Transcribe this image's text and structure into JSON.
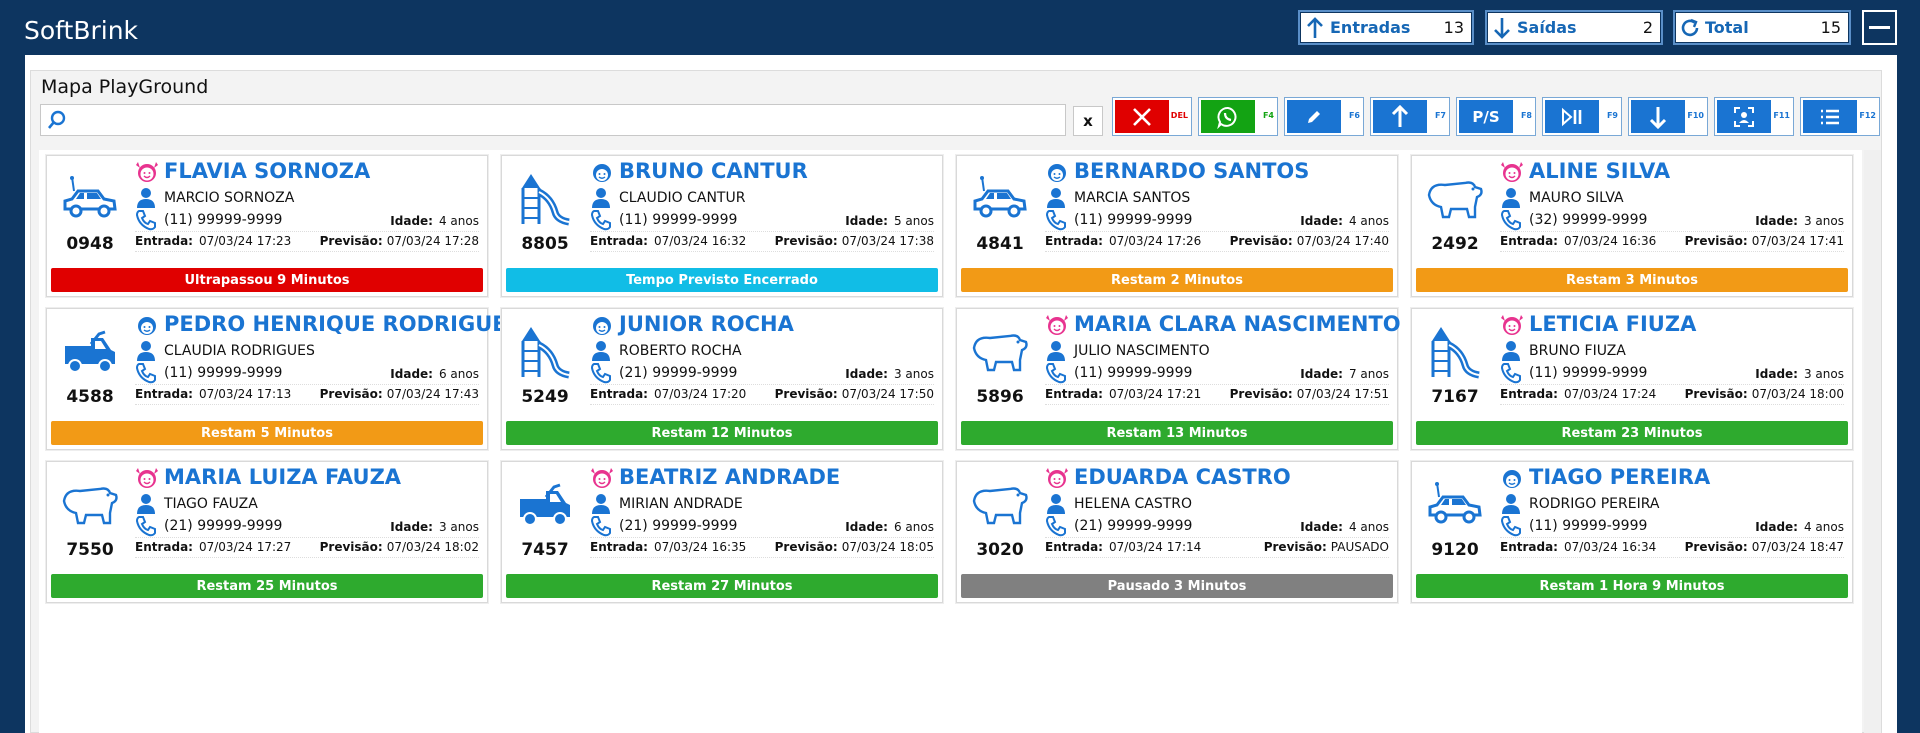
{
  "app": {
    "title": "SoftBrink"
  },
  "counters": [
    {
      "label": "Entradas",
      "value": "13",
      "icon": "arrow-up-icon"
    },
    {
      "label": "Saídas",
      "value": "2",
      "icon": "arrow-down-icon"
    },
    {
      "label": "Total",
      "value": "15",
      "icon": "refresh-icon"
    }
  ],
  "panel": {
    "title": "Mapa PlayGround"
  },
  "search": {
    "value": "",
    "placeholder": "",
    "clear_label": "x"
  },
  "toolbar": [
    {
      "name": "delete-button",
      "key": "DEL",
      "icon": "close-icon"
    },
    {
      "name": "whatsapp-button",
      "key": "F4",
      "icon": "whatsapp-icon"
    },
    {
      "name": "edit-button",
      "key": "F6",
      "icon": "pencil-icon"
    },
    {
      "name": "entry-button",
      "key": "F7",
      "icon": "arrow-up-icon"
    },
    {
      "name": "ps-button",
      "key": "F8",
      "icon": "ps-text-icon",
      "text": "P/S"
    },
    {
      "name": "play-pause-button",
      "key": "F9",
      "icon": "play-pause-icon"
    },
    {
      "name": "exit-button",
      "key": "F10",
      "icon": "arrow-down-icon"
    },
    {
      "name": "face-scan-button",
      "key": "F11",
      "icon": "face-scan-icon"
    },
    {
      "name": "list-button",
      "key": "F12",
      "icon": "list-icon"
    }
  ],
  "colors": {
    "header_bg": "#0d3560",
    "accent": "#1a74d2",
    "status_red": "#e00000",
    "status_cyan": "#11bde6",
    "status_orange": "#f29a16",
    "status_green": "#2eaa2e",
    "status_gray": "#808080",
    "girl_icon": "#e8338f",
    "boy_icon": "#1a74d2"
  },
  "labels": {
    "age": "Idade:",
    "entry": "Entrada:",
    "forecast": "Previsão:"
  },
  "cards": [
    {
      "code": "0948",
      "icon": "car-icon",
      "gender": "girl",
      "name": "FLAVIA SORNOZA",
      "parent": "MARCIO SORNOZA",
      "phone": "(11) 99999-9999",
      "age": "4 anos",
      "entry": "07/03/24 17:23",
      "forecast": "07/03/24 17:28",
      "status": "Ultrapassou 9 Minutos",
      "status_color": "red"
    },
    {
      "code": "8805",
      "icon": "slide-icon",
      "gender": "boy",
      "name": "BRUNO CANTUR",
      "parent": "CLAUDIO CANTUR",
      "phone": "(11) 99999-9999",
      "age": "5 anos",
      "entry": "07/03/24 16:32",
      "forecast": "07/03/24 17:38",
      "status": "Tempo Previsto Encerrado",
      "status_color": "cyan"
    },
    {
      "code": "4841",
      "icon": "car-icon",
      "gender": "boy",
      "name": "BERNARDO SANTOS",
      "parent": "MARCIA SANTOS",
      "phone": "(11) 99999-9999",
      "age": "4 anos",
      "entry": "07/03/24 17:26",
      "forecast": "07/03/24 17:40",
      "status": "Restam 2 Minutos",
      "status_color": "orange"
    },
    {
      "code": "2492",
      "icon": "bear-icon",
      "gender": "girl",
      "name": "ALINE SILVA",
      "parent": "MAURO SILVA",
      "phone": "(32) 99999-9999",
      "age": "3 anos",
      "entry": "07/03/24 16:36",
      "forecast": "07/03/24 17:41",
      "status": "Restam 3 Minutos",
      "status_color": "orange"
    },
    {
      "code": "4588",
      "icon": "truck-icon",
      "gender": "boy",
      "name": "PEDRO HENRIQUE RODRIGUES",
      "parent": "CLAUDIA RODRIGUES",
      "phone": "(11) 99999-9999",
      "age": "6 anos",
      "entry": "07/03/24 17:13",
      "forecast": "07/03/24 17:43",
      "status": "Restam 5 Minutos",
      "status_color": "orange"
    },
    {
      "code": "5249",
      "icon": "slide-icon",
      "gender": "boy",
      "name": "JUNIOR ROCHA",
      "parent": "ROBERTO ROCHA",
      "phone": "(21) 99999-9999",
      "age": "3 anos",
      "entry": "07/03/24 17:20",
      "forecast": "07/03/24 17:50",
      "status": "Restam 12 Minutos",
      "status_color": "green"
    },
    {
      "code": "5896",
      "icon": "bear-icon",
      "gender": "girl",
      "name": "MARIA CLARA NASCIMENTO",
      "parent": "JULIO NASCIMENTO",
      "phone": "(11) 99999-9999",
      "age": "7 anos",
      "entry": "07/03/24 17:21",
      "forecast": "07/03/24 17:51",
      "status": "Restam 13 Minutos",
      "status_color": "green"
    },
    {
      "code": "7167",
      "icon": "slide-icon",
      "gender": "girl",
      "name": "LETICIA FIUZA",
      "parent": "BRUNO FIUZA",
      "phone": "(11) 99999-9999",
      "age": "3 anos",
      "entry": "07/03/24 17:24",
      "forecast": "07/03/24 18:00",
      "status": "Restam 23 Minutos",
      "status_color": "green"
    },
    {
      "code": "7550",
      "icon": "bear-icon",
      "gender": "girl",
      "name": "MARIA LUIZA FAUZA",
      "parent": "TIAGO FAUZA",
      "phone": "(21) 99999-9999",
      "age": "3 anos",
      "entry": "07/03/24 17:27",
      "forecast": "07/03/24 18:02",
      "status": "Restam 25 Minutos",
      "status_color": "green"
    },
    {
      "code": "7457",
      "icon": "truck-icon",
      "gender": "girl",
      "name": "BEATRIZ ANDRADE",
      "parent": "MIRIAN ANDRADE",
      "phone": "(21) 99999-9999",
      "age": "6 anos",
      "entry": "07/03/24 16:35",
      "forecast": "07/03/24 18:05",
      "status": "Restam 27 Minutos",
      "status_color": "green"
    },
    {
      "code": "3020",
      "icon": "bear-icon",
      "gender": "girl",
      "name": "EDUARDA CASTRO",
      "parent": "HELENA CASTRO",
      "phone": "(21) 99999-9999",
      "age": "4 anos",
      "entry": "07/03/24 17:14",
      "forecast": "PAUSADO",
      "status": "Pausado 3 Minutos",
      "status_color": "gray"
    },
    {
      "code": "9120",
      "icon": "car-icon",
      "gender": "boy",
      "name": "TIAGO PEREIRA",
      "parent": "RODRIGO PEREIRA",
      "phone": "(11) 99999-9999",
      "age": "4 anos",
      "entry": "07/03/24 16:34",
      "forecast": "07/03/24 18:47",
      "status": "Restam 1 Hora 9 Minutos",
      "status_color": "green"
    }
  ]
}
